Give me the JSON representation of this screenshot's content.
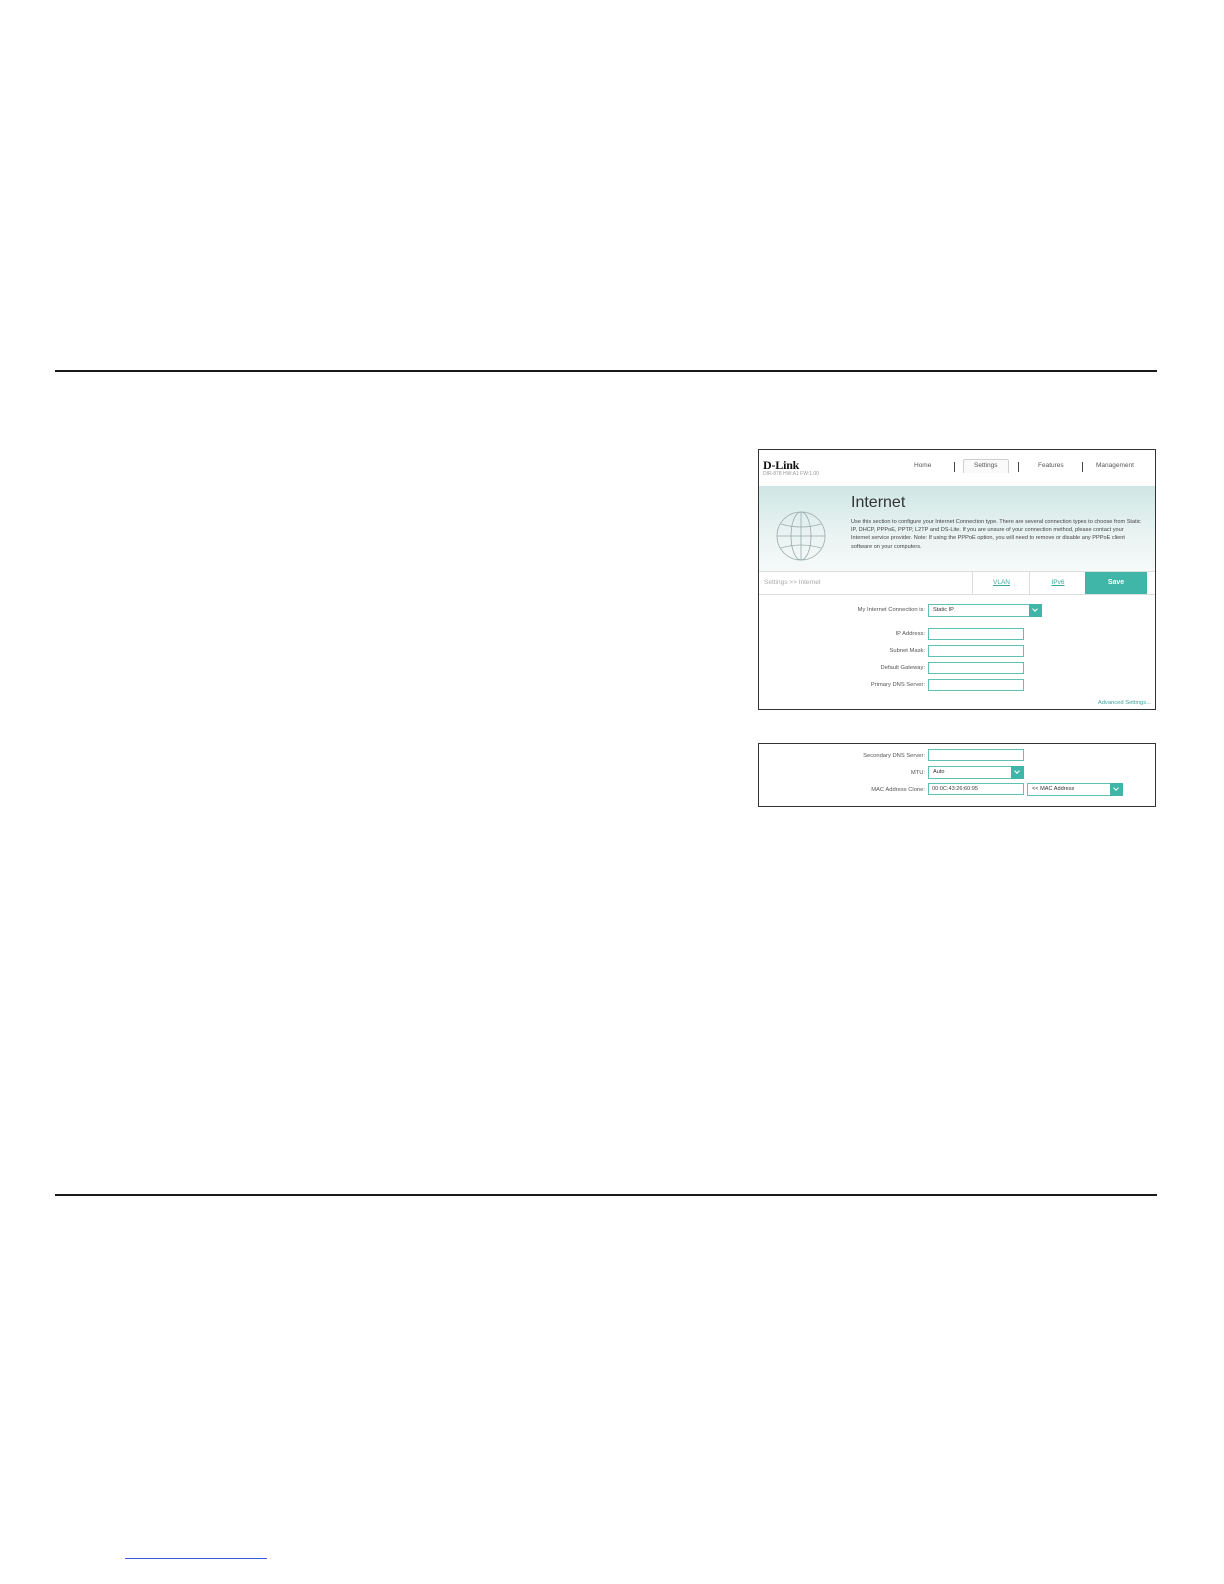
{
  "screenshot1": {
    "logo": "D-Link",
    "model": "DIR-878 HW:A1 FW:1.00",
    "nav": [
      "Home",
      "Settings",
      "Features",
      "Management"
    ],
    "hero_title": "Internet",
    "hero_desc": "Use this section to configure your Internet Connection type. There are several connection types to choose from Static IP, DHCP, PPPoE, PPTP, L2TP and DS-Lite. If you are unsure of your connection method, please contact your Internet service provider. Note: If using the PPPoE option, you will need to remove or disable any PPPoE client software on your computers.",
    "breadcrumb": "Settings >> Internet",
    "tabs": {
      "vlan": "VLAN",
      "ipv6": "IPv6",
      "save": "Save"
    },
    "connection_label": "My Internet Connection is:",
    "connection_value": "Static IP",
    "fields": [
      {
        "label": "IP Address:",
        "value": ""
      },
      {
        "label": "Subnet Mask:",
        "value": ""
      },
      {
        "label": "Default Gateway:",
        "value": ""
      },
      {
        "label": "Primary DNS Server:",
        "value": ""
      }
    ],
    "advanced_link": "Advanced Settings..."
  },
  "screenshot2": {
    "secondary_dns_label": "Secondary DNS Server:",
    "secondary_dns_value": "",
    "mtu_label": "MTU:",
    "mtu_value": "Auto",
    "mac_label": "MAC Address Clone:",
    "mac_value": "00:0C:43:26:60:95",
    "mac_select_value": "<< MAC Address"
  }
}
